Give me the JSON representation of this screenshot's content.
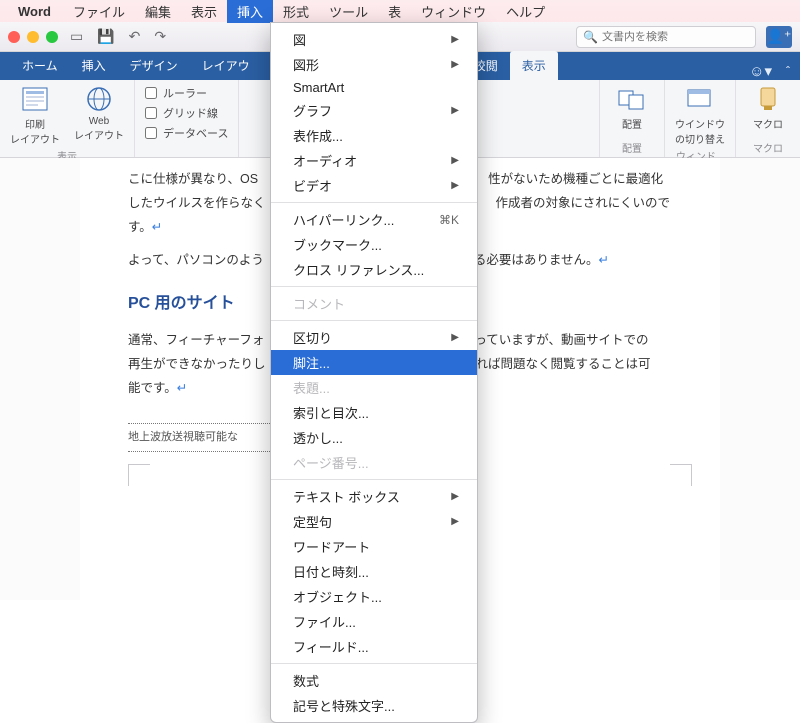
{
  "menubar": {
    "app": "Word",
    "items": [
      "ファイル",
      "編集",
      "表示",
      "挿入",
      "形式",
      "ツール",
      "表",
      "ウィンドウ",
      "ヘルプ"
    ],
    "active_index": 3
  },
  "titlebar": {
    "search_placeholder": "文書内を検索"
  },
  "ribbon_tabs": {
    "tabs": [
      "ホーム",
      "挿入",
      "デザイン",
      "レイアウ",
      "",
      "",
      "校閲",
      "表示"
    ],
    "active_index": 7
  },
  "ribbon": {
    "group_view": {
      "label": "表示",
      "print_layout": "印刷\nレイアウト",
      "web_layout": "Web\nレイアウト"
    },
    "group_show": {
      "ruler": "ルーラー",
      "gridlines": "グリッド線",
      "database": "データベース"
    },
    "group_arrange": {
      "label": "配置",
      "btn": "配置"
    },
    "group_window": {
      "label": "ウィンド...",
      "btn": "ウインドウ\nの切り替え"
    },
    "group_macro": {
      "label": "マクロ",
      "btn": "マクロ"
    }
  },
  "dropmenu": {
    "items": [
      {
        "label": "図",
        "arrow": true
      },
      {
        "label": "図形",
        "arrow": true
      },
      {
        "label": "SmartArt"
      },
      {
        "label": "グラフ",
        "arrow": true
      },
      {
        "label": "表作成..."
      },
      {
        "label": "オーディオ",
        "arrow": true
      },
      {
        "label": "ビデオ",
        "arrow": true
      },
      {
        "sep": true
      },
      {
        "label": "ハイパーリンク...",
        "shortcut": "⌘K"
      },
      {
        "label": "ブックマーク..."
      },
      {
        "label": "クロス リファレンス..."
      },
      {
        "sep": true
      },
      {
        "label": "コメント",
        "disabled": true
      },
      {
        "sep": true
      },
      {
        "label": "区切り",
        "arrow": true
      },
      {
        "label": "脚注...",
        "selected": true
      },
      {
        "label": "表題...",
        "disabled": true
      },
      {
        "label": "索引と目次..."
      },
      {
        "label": "透かし..."
      },
      {
        "label": "ページ番号...",
        "disabled": true
      },
      {
        "sep": true
      },
      {
        "label": "テキスト ボックス",
        "arrow": true
      },
      {
        "label": "定型句",
        "arrow": true
      },
      {
        "label": "ワードアート"
      },
      {
        "label": "日付と時刻..."
      },
      {
        "label": "オブジェクト..."
      },
      {
        "label": "ファイル..."
      },
      {
        "label": "フィールド..."
      },
      {
        "sep": true
      },
      {
        "label": "数式"
      },
      {
        "label": "記号と特殊文字..."
      }
    ]
  },
  "document": {
    "line1_a": "こに仕様が異なり、OS",
    "line1_b": "性がないため機種ごとに最適化",
    "line2": "したウイルスを作らなく",
    "line2_b": "作成者の対象にされにくいので",
    "line3": "す。",
    "line4_a": "よって、パソコンのよう",
    "line4_b": "る必要はありません。",
    "heading": "PC 用のサイト",
    "p2a": "通常、フィーチャーフォ",
    "p2b": "っていますが、動画サイトでの",
    "p3a": "再生ができなかったりし",
    "p3b": "れば問題なく閲覧することは可",
    "p4": "能です。",
    "footref": "地上波放送視聴可能な"
  }
}
